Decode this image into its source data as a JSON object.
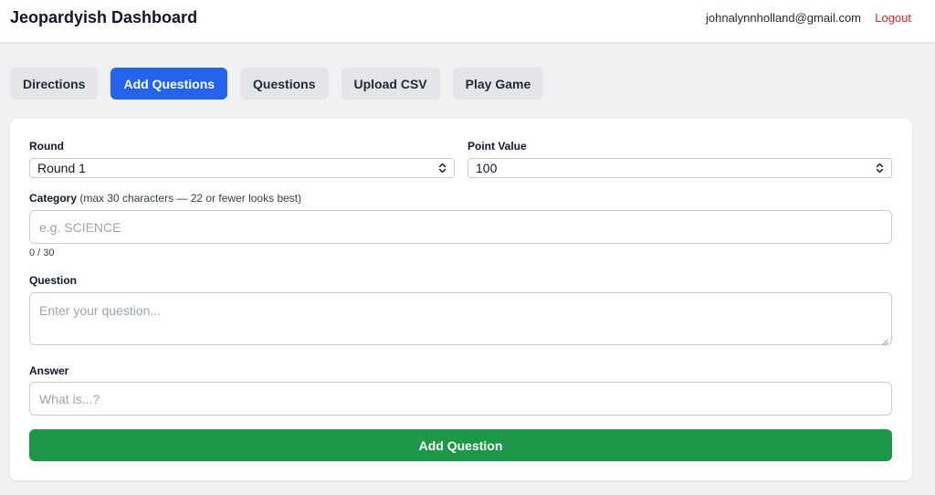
{
  "header": {
    "title": "Jeopardyish Dashboard",
    "email": "johnalynnholland@gmail.com",
    "logout_label": "Logout"
  },
  "tabs": [
    {
      "label": "Directions",
      "active": false
    },
    {
      "label": "Add Questions",
      "active": true
    },
    {
      "label": "Questions",
      "active": false
    },
    {
      "label": "Upload CSV",
      "active": false
    },
    {
      "label": "Play Game",
      "active": false
    }
  ],
  "form": {
    "round": {
      "label": "Round",
      "value": "Round 1"
    },
    "point_value": {
      "label": "Point Value",
      "value": "100"
    },
    "category": {
      "label": "Category",
      "hint": "(max 30 characters — 22 or fewer looks best)",
      "placeholder": "e.g. SCIENCE",
      "counter": "0 / 30"
    },
    "question": {
      "label": "Question",
      "placeholder": "Enter your question..."
    },
    "answer": {
      "label": "Answer",
      "placeholder": "What is...?"
    },
    "submit_label": "Add Question"
  },
  "colors": {
    "accent": "#2463eb",
    "submit": "#1e9748",
    "logout": "#dc2626",
    "background": "#f0f1f3"
  }
}
